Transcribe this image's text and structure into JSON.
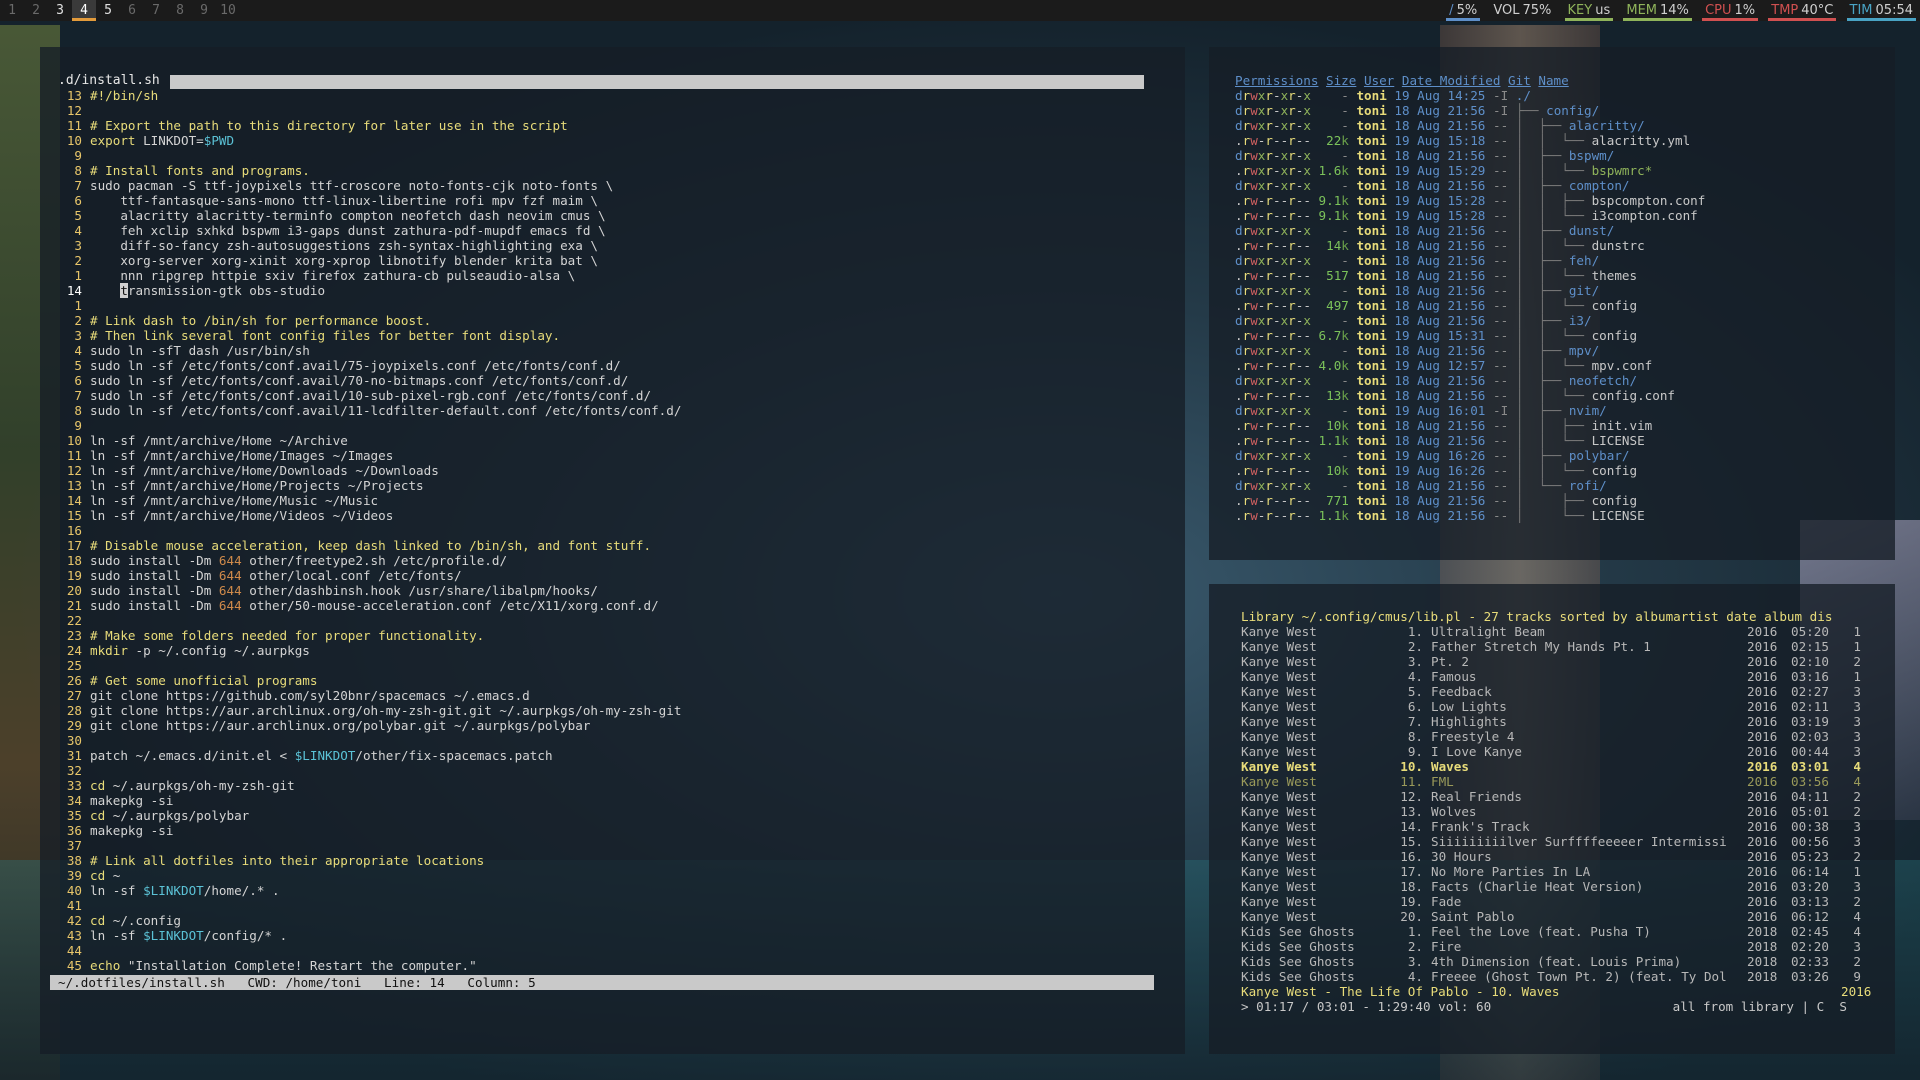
{
  "colors": {
    "bar_bg": "#1b1b1b",
    "focus_underline": "#e39b3b",
    "comment": "#e8dc7a",
    "variable": "#5bc2d6",
    "dir": "#5e8fc9"
  },
  "topbar": {
    "workspaces": [
      "1",
      "2",
      "3",
      "4",
      "5",
      "6",
      "7",
      "8",
      "9",
      "10"
    ],
    "occupied": [
      "3",
      "4",
      "5"
    ],
    "focused": "4",
    "modules": {
      "disk_icon": "/",
      "disk": "5%",
      "vol_label": "VOL",
      "vol": "75%",
      "key_label": "KEY",
      "key": "us",
      "mem_label": "MEM",
      "mem": "14%",
      "cpu_label": "CPU",
      "cpu": "1%",
      "tmp_label": "TMP",
      "tmp": "40°C",
      "tim_label": "TIM",
      "tim": "05:54"
    }
  },
  "editor": {
    "title": ".d/install.sh",
    "lines": [
      {
        "n": "13",
        "t": "#!/bin/sh",
        "k": "cm"
      },
      {
        "n": "12",
        "t": "",
        "k": ""
      },
      {
        "n": "11",
        "t": "# Export the path to this directory for later use in the script",
        "k": "cm"
      },
      {
        "n": "10",
        "t": "export LINKDOT=$PWD",
        "k": "export"
      },
      {
        "n": "9",
        "t": "",
        "k": ""
      },
      {
        "n": "8",
        "t": "# Install fonts and programs.",
        "k": "cm"
      },
      {
        "n": "7",
        "t": "sudo pacman -S ttf-joypixels ttf-croscore noto-fonts-cjk noto-fonts \\",
        "k": ""
      },
      {
        "n": "6",
        "t": "    ttf-fantasque-sans-mono ttf-linux-libertine rofi mpv fzf maim \\",
        "k": ""
      },
      {
        "n": "5",
        "t": "    alacritty alacritty-terminfo compton neofetch dash neovim cmus \\",
        "k": ""
      },
      {
        "n": "4",
        "t": "    feh xclip sxhkd bspwm i3-gaps dunst zathura-pdf-mupdf emacs fd \\",
        "k": ""
      },
      {
        "n": "3",
        "t": "    diff-so-fancy zsh-autosuggestions zsh-syntax-highlighting exa \\",
        "k": ""
      },
      {
        "n": "2",
        "t": "    xorg-server xorg-xinit xorg-xprop libnotify blender krita bat \\",
        "k": ""
      },
      {
        "n": "1",
        "t": "    nnn ripgrep httpie sxiv firefox zathura-cb pulseaudio-alsa \\",
        "k": ""
      },
      {
        "n": "14",
        "t": "    transmission-gtk obs-studio",
        "k": "cur"
      },
      {
        "n": "1",
        "t": "",
        "k": ""
      },
      {
        "n": "2",
        "t": "# Link dash to /bin/sh for performance boost.",
        "k": "cm"
      },
      {
        "n": "3",
        "t": "# Then link several font config files for better font display.",
        "k": "cm"
      },
      {
        "n": "4",
        "t": "sudo ln -sfT dash /usr/bin/sh",
        "k": ""
      },
      {
        "n": "5",
        "t": "sudo ln -sf /etc/fonts/conf.avail/75-joypixels.conf /etc/fonts/conf.d/",
        "k": ""
      },
      {
        "n": "6",
        "t": "sudo ln -sf /etc/fonts/conf.avail/70-no-bitmaps.conf /etc/fonts/conf.d/",
        "k": ""
      },
      {
        "n": "7",
        "t": "sudo ln -sf /etc/fonts/conf.avail/10-sub-pixel-rgb.conf /etc/fonts/conf.d/",
        "k": ""
      },
      {
        "n": "8",
        "t": "sudo ln -sf /etc/fonts/conf.avail/11-lcdfilter-default.conf /etc/fonts/conf.d/",
        "k": ""
      },
      {
        "n": "9",
        "t": "",
        "k": ""
      },
      {
        "n": "10",
        "t": "ln -sf /mnt/archive/Home ~/Archive",
        "k": ""
      },
      {
        "n": "11",
        "t": "ln -sf /mnt/archive/Home/Images ~/Images",
        "k": ""
      },
      {
        "n": "12",
        "t": "ln -sf /mnt/archive/Home/Downloads ~/Downloads",
        "k": ""
      },
      {
        "n": "13",
        "t": "ln -sf /mnt/archive/Home/Projects ~/Projects",
        "k": ""
      },
      {
        "n": "14",
        "t": "ln -sf /mnt/archive/Home/Music ~/Music",
        "k": ""
      },
      {
        "n": "15",
        "t": "ln -sf /mnt/archive/Home/Videos ~/Videos",
        "k": ""
      },
      {
        "n": "16",
        "t": "",
        "k": ""
      },
      {
        "n": "17",
        "t": "# Disable mouse acceleration, keep dash linked to /bin/sh, and font stuff.",
        "k": "cm"
      },
      {
        "n": "18",
        "t": "sudo install -Dm 644 other/freetype2.sh /etc/profile.d/",
        "k": "install"
      },
      {
        "n": "19",
        "t": "sudo install -Dm 644 other/local.conf /etc/fonts/",
        "k": "install"
      },
      {
        "n": "20",
        "t": "sudo install -Dm 644 other/dashbinsh.hook /usr/share/libalpm/hooks/",
        "k": "install"
      },
      {
        "n": "21",
        "t": "sudo install -Dm 644 other/50-mouse-acceleration.conf /etc/X11/xorg.conf.d/",
        "k": "install"
      },
      {
        "n": "22",
        "t": "",
        "k": ""
      },
      {
        "n": "23",
        "t": "# Make some folders needed for proper functionality.",
        "k": "cm"
      },
      {
        "n": "24",
        "t": "mkdir -p ~/.config ~/.aurpkgs",
        "k": "mkdir"
      },
      {
        "n": "25",
        "t": "",
        "k": ""
      },
      {
        "n": "26",
        "t": "# Get some unofficial programs",
        "k": "cm"
      },
      {
        "n": "27",
        "t": "git clone https://github.com/syl20bnr/spacemacs ~/.emacs.d",
        "k": ""
      },
      {
        "n": "28",
        "t": "git clone https://aur.archlinux.org/oh-my-zsh-git.git ~/.aurpkgs/oh-my-zsh-git",
        "k": ""
      },
      {
        "n": "29",
        "t": "git clone https://aur.archlinux.org/polybar.git ~/.aurpkgs/polybar",
        "k": ""
      },
      {
        "n": "30",
        "t": "",
        "k": ""
      },
      {
        "n": "31",
        "t": "patch ~/.emacs.d/init.el < $LINKDOT/other/fix-spacemacs.patch",
        "k": "patch"
      },
      {
        "n": "32",
        "t": "",
        "k": ""
      },
      {
        "n": "33",
        "t": "cd ~/.aurpkgs/oh-my-zsh-git",
        "k": "kw"
      },
      {
        "n": "34",
        "t": "makepkg -si",
        "k": ""
      },
      {
        "n": "35",
        "t": "cd ~/.aurpkgs/polybar",
        "k": "kw"
      },
      {
        "n": "36",
        "t": "makepkg -si",
        "k": ""
      },
      {
        "n": "37",
        "t": "",
        "k": ""
      },
      {
        "n": "38",
        "t": "# Link all dotfiles into their appropriate locations",
        "k": "cm"
      },
      {
        "n": "39",
        "t": "cd ~",
        "k": "kw"
      },
      {
        "n": "40",
        "t": "ln -sf $LINKDOT/home/.* .",
        "k": "var"
      },
      {
        "n": "41",
        "t": "",
        "k": ""
      },
      {
        "n": "42",
        "t": "cd ~/.config",
        "k": "kw"
      },
      {
        "n": "43",
        "t": "ln -sf $LINKDOT/config/* .",
        "k": "var"
      },
      {
        "n": "44",
        "t": "",
        "k": ""
      },
      {
        "n": "45",
        "t": "echo \"Installation Complete! Restart the computer.\"",
        "k": "kw"
      }
    ],
    "status": "~/.dotfiles/install.sh   CWD: /home/toni   Line: 14   Column: 5"
  },
  "files": {
    "headers": [
      "Permissions",
      "Size",
      "User",
      "Date Modified",
      "Git",
      "Name"
    ],
    "rows": [
      {
        "perm": "drwxr-xr-x",
        "size": "-",
        "user": "toni",
        "date": "19 Aug 14:25",
        "git": "-I",
        "tree": "",
        "name": "./",
        "dir": true
      },
      {
        "perm": "drwxr-xr-x",
        "size": "-",
        "user": "toni",
        "date": "18 Aug 21:56",
        "git": "-I",
        "tree": "├── ",
        "name": "config/",
        "dir": true
      },
      {
        "perm": "drwxr-xr-x",
        "size": "-",
        "user": "toni",
        "date": "18 Aug 21:56",
        "git": "--",
        "tree": "│  ├── ",
        "name": "alacritty/",
        "dir": true
      },
      {
        "perm": ".rw-r--r--",
        "size": "22k",
        "user": "toni",
        "date": "19 Aug 15:18",
        "git": "--",
        "tree": "│  │  └── ",
        "name": "alacritty.yml",
        "dir": false
      },
      {
        "perm": "drwxr-xr-x",
        "size": "-",
        "user": "toni",
        "date": "18 Aug 21:56",
        "git": "--",
        "tree": "│  ├── ",
        "name": "bspwm/",
        "dir": true
      },
      {
        "perm": ".rwxr-xr-x",
        "size": "1.6k",
        "user": "toni",
        "date": "19 Aug 15:29",
        "git": "--",
        "tree": "│  │  └── ",
        "name": "bspwmrc*",
        "dir": false,
        "exec": true
      },
      {
        "perm": "drwxr-xr-x",
        "size": "-",
        "user": "toni",
        "date": "18 Aug 21:56",
        "git": "--",
        "tree": "│  ├── ",
        "name": "compton/",
        "dir": true
      },
      {
        "perm": ".rw-r--r--",
        "size": "9.1k",
        "user": "toni",
        "date": "19 Aug 15:28",
        "git": "--",
        "tree": "│  │  ├── ",
        "name": "bspcompton.conf",
        "dir": false
      },
      {
        "perm": ".rw-r--r--",
        "size": "9.1k",
        "user": "toni",
        "date": "19 Aug 15:28",
        "git": "--",
        "tree": "│  │  └── ",
        "name": "i3compton.conf",
        "dir": false
      },
      {
        "perm": "drwxr-xr-x",
        "size": "-",
        "user": "toni",
        "date": "18 Aug 21:56",
        "git": "--",
        "tree": "│  ├── ",
        "name": "dunst/",
        "dir": true
      },
      {
        "perm": ".rw-r--r--",
        "size": "14k",
        "user": "toni",
        "date": "18 Aug 21:56",
        "git": "--",
        "tree": "│  │  └── ",
        "name": "dunstrc",
        "dir": false
      },
      {
        "perm": "drwxr-xr-x",
        "size": "-",
        "user": "toni",
        "date": "18 Aug 21:56",
        "git": "--",
        "tree": "│  ├── ",
        "name": "feh/",
        "dir": true
      },
      {
        "perm": ".rw-r--r--",
        "size": "517",
        "user": "toni",
        "date": "18 Aug 21:56",
        "git": "--",
        "tree": "│  │  └── ",
        "name": "themes",
        "dir": false
      },
      {
        "perm": "drwxr-xr-x",
        "size": "-",
        "user": "toni",
        "date": "18 Aug 21:56",
        "git": "--",
        "tree": "│  ├── ",
        "name": "git/",
        "dir": true
      },
      {
        "perm": ".rw-r--r--",
        "size": "497",
        "user": "toni",
        "date": "18 Aug 21:56",
        "git": "--",
        "tree": "│  │  └── ",
        "name": "config",
        "dir": false
      },
      {
        "perm": "drwxr-xr-x",
        "size": "-",
        "user": "toni",
        "date": "18 Aug 21:56",
        "git": "--",
        "tree": "│  ├── ",
        "name": "i3/",
        "dir": true
      },
      {
        "perm": ".rw-r--r--",
        "size": "6.7k",
        "user": "toni",
        "date": "19 Aug 15:31",
        "git": "--",
        "tree": "│  │  └── ",
        "name": "config",
        "dir": false
      },
      {
        "perm": "drwxr-xr-x",
        "size": "-",
        "user": "toni",
        "date": "18 Aug 21:56",
        "git": "--",
        "tree": "│  ├── ",
        "name": "mpv/",
        "dir": true
      },
      {
        "perm": ".rw-r--r--",
        "size": "4.0k",
        "user": "toni",
        "date": "19 Aug 12:57",
        "git": "--",
        "tree": "│  │  └── ",
        "name": "mpv.conf",
        "dir": false
      },
      {
        "perm": "drwxr-xr-x",
        "size": "-",
        "user": "toni",
        "date": "18 Aug 21:56",
        "git": "--",
        "tree": "│  ├── ",
        "name": "neofetch/",
        "dir": true
      },
      {
        "perm": ".rw-r--r--",
        "size": "13k",
        "user": "toni",
        "date": "18 Aug 21:56",
        "git": "--",
        "tree": "│  │  └── ",
        "name": "config.conf",
        "dir": false
      },
      {
        "perm": "drwxr-xr-x",
        "size": "-",
        "user": "toni",
        "date": "19 Aug 16:01",
        "git": "-I",
        "tree": "│  ├── ",
        "name": "nvim/",
        "dir": true
      },
      {
        "perm": ".rw-r--r--",
        "size": "10k",
        "user": "toni",
        "date": "18 Aug 21:56",
        "git": "--",
        "tree": "│  │  ├── ",
        "name": "init.vim",
        "dir": false
      },
      {
        "perm": ".rw-r--r--",
        "size": "1.1k",
        "user": "toni",
        "date": "18 Aug 21:56",
        "git": "--",
        "tree": "│  │  └── ",
        "name": "LICENSE",
        "dir": false
      },
      {
        "perm": "drwxr-xr-x",
        "size": "-",
        "user": "toni",
        "date": "19 Aug 16:26",
        "git": "--",
        "tree": "│  ├── ",
        "name": "polybar/",
        "dir": true
      },
      {
        "perm": ".rw-r--r--",
        "size": "10k",
        "user": "toni",
        "date": "19 Aug 16:26",
        "git": "--",
        "tree": "│  │  └── ",
        "name": "config",
        "dir": false
      },
      {
        "perm": "drwxr-xr-x",
        "size": "-",
        "user": "toni",
        "date": "18 Aug 21:56",
        "git": "--",
        "tree": "│  └── ",
        "name": "rofi/",
        "dir": true
      },
      {
        "perm": ".rw-r--r--",
        "size": "771",
        "user": "toni",
        "date": "18 Aug 21:56",
        "git": "--",
        "tree": "│     ├── ",
        "name": "config",
        "dir": false
      },
      {
        "perm": ".rw-r--r--",
        "size": "1.1k",
        "user": "toni",
        "date": "18 Aug 21:56",
        "git": "--",
        "tree": "│     └── ",
        "name": "LICENSE",
        "dir": false
      }
    ]
  },
  "music": {
    "header": "Library ~/.config/cmus/lib.pl - 27 tracks sorted by albumartist date album dis",
    "rows": [
      {
        "artist": "Kanye West",
        "num": "1.",
        "title": "Ultralight Beam",
        "year": "2016",
        "dur": "05:20",
        "disc": "1"
      },
      {
        "artist": "Kanye West",
        "num": "2.",
        "title": "Father Stretch My Hands Pt. 1",
        "year": "2016",
        "dur": "02:15",
        "disc": "1"
      },
      {
        "artist": "Kanye West",
        "num": "3.",
        "title": "Pt. 2",
        "year": "2016",
        "dur": "02:10",
        "disc": "2"
      },
      {
        "artist": "Kanye West",
        "num": "4.",
        "title": "Famous",
        "year": "2016",
        "dur": "03:16",
        "disc": "1"
      },
      {
        "artist": "Kanye West",
        "num": "5.",
        "title": "Feedback",
        "year": "2016",
        "dur": "02:27",
        "disc": "3"
      },
      {
        "artist": "Kanye West",
        "num": "6.",
        "title": "Low Lights",
        "year": "2016",
        "dur": "02:11",
        "disc": "3"
      },
      {
        "artist": "Kanye West",
        "num": "7.",
        "title": "Highlights",
        "year": "2016",
        "dur": "03:19",
        "disc": "3"
      },
      {
        "artist": "Kanye West",
        "num": "8.",
        "title": "Freestyle 4",
        "year": "2016",
        "dur": "02:03",
        "disc": "3"
      },
      {
        "artist": "Kanye West",
        "num": "9.",
        "title": "I Love Kanye",
        "year": "2016",
        "dur": "00:44",
        "disc": "3"
      },
      {
        "artist": "Kanye West",
        "num": "10.",
        "title": "Waves",
        "year": "2016",
        "dur": "03:01",
        "disc": "4",
        "active": true
      },
      {
        "artist": "Kanye West",
        "num": "11.",
        "title": "FML",
        "year": "2016",
        "dur": "03:56",
        "disc": "4",
        "faded": true
      },
      {
        "artist": "Kanye West",
        "num": "12.",
        "title": "Real Friends",
        "year": "2016",
        "dur": "04:11",
        "disc": "2"
      },
      {
        "artist": "Kanye West",
        "num": "13.",
        "title": "Wolves",
        "year": "2016",
        "dur": "05:01",
        "disc": "2"
      },
      {
        "artist": "Kanye West",
        "num": "14.",
        "title": "Frank's Track",
        "year": "2016",
        "dur": "00:38",
        "disc": "3"
      },
      {
        "artist": "Kanye West",
        "num": "15.",
        "title": "Siiiiiiiiilver Surffffeeeeer Intermissi",
        "year": "2016",
        "dur": "00:56",
        "disc": "3"
      },
      {
        "artist": "Kanye West",
        "num": "16.",
        "title": "30 Hours",
        "year": "2016",
        "dur": "05:23",
        "disc": "2"
      },
      {
        "artist": "Kanye West",
        "num": "17.",
        "title": "No More Parties In LA",
        "year": "2016",
        "dur": "06:14",
        "disc": "1"
      },
      {
        "artist": "Kanye West",
        "num": "18.",
        "title": "Facts (Charlie Heat Version)",
        "year": "2016",
        "dur": "03:20",
        "disc": "3"
      },
      {
        "artist": "Kanye West",
        "num": "19.",
        "title": "Fade",
        "year": "2016",
        "dur": "03:13",
        "disc": "2"
      },
      {
        "artist": "Kanye West",
        "num": "20.",
        "title": "Saint Pablo",
        "year": "2016",
        "dur": "06:12",
        "disc": "4"
      },
      {
        "artist": "Kids See Ghosts",
        "num": "1.",
        "title": "Feel the Love (feat. Pusha T)",
        "year": "2018",
        "dur": "02:45",
        "disc": "4"
      },
      {
        "artist": "Kids See Ghosts",
        "num": "2.",
        "title": "Fire",
        "year": "2018",
        "dur": "02:20",
        "disc": "3"
      },
      {
        "artist": "Kids See Ghosts",
        "num": "3.",
        "title": "4th Dimension (feat. Louis Prima)",
        "year": "2018",
        "dur": "02:33",
        "disc": "2"
      },
      {
        "artist": "Kids See Ghosts",
        "num": "4.",
        "title": "Freeee (Ghost Town Pt. 2) (feat. Ty Dol",
        "year": "2018",
        "dur": "03:26",
        "disc": "9"
      }
    ],
    "now_playing": "Kanye West - The Life Of Pablo - 10. Waves",
    "now_playing_year": "2016",
    "progress": "> 01:17 / 03:01 - 1:29:40 vol: 60",
    "mode": "all from library | C  S"
  }
}
